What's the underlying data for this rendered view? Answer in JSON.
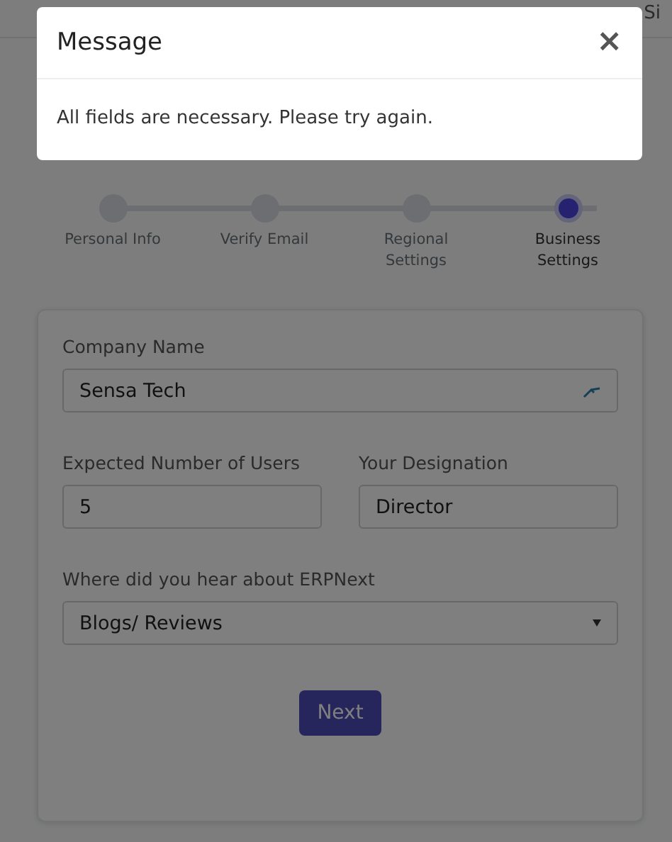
{
  "nav": [
    "Si"
  ],
  "steps": [
    {
      "label": "Personal Info",
      "selected": false
    },
    {
      "label": "Verify Email",
      "selected": false
    },
    {
      "label": "Regional Settings",
      "selected": false
    },
    {
      "label": "Business Settings",
      "selected": true
    }
  ],
  "form": {
    "company_label": "Company Name",
    "company_value": "Sensa Tech",
    "users_label": "Expected Number of Users",
    "users_value": "5",
    "designation_label": "Your Designation",
    "designation_value": "Director",
    "source_label": "Where did you hear about ERPNext",
    "source_value": "Blogs/ Reviews",
    "next_button": "Next"
  },
  "dialog": {
    "title": "Message",
    "close": "×",
    "message": "All fields are necessary. Please try again."
  }
}
